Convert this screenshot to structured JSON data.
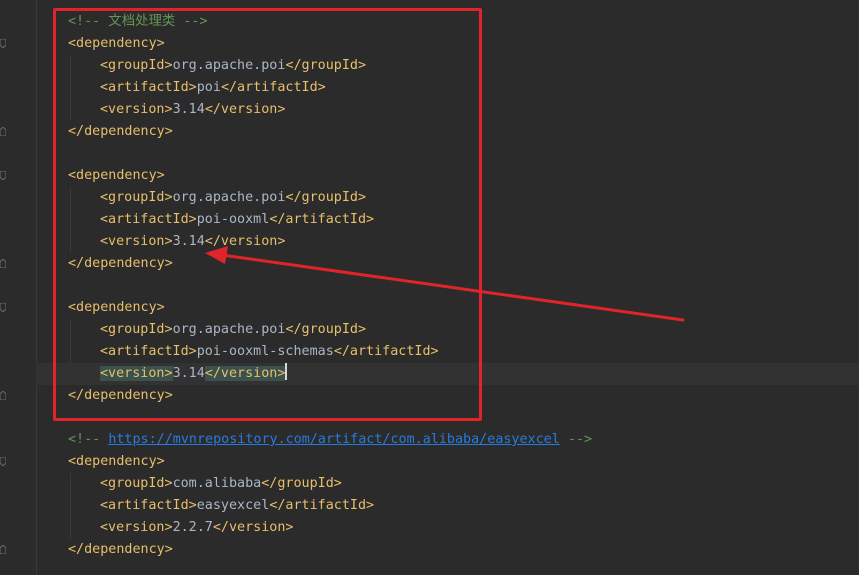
{
  "editor": {
    "comment_poi": "<!-- 文档处理类 -->",
    "dep_open": "<dependency>",
    "dep_close": "</dependency>",
    "groupId_open": "<groupId>",
    "groupId_close": "</groupId>",
    "artifactId_open": "<artifactId>",
    "artifactId_close": "</artifactId>",
    "version_open": "<version>",
    "version_close": "</version>",
    "comment_prefix": "<!-- ",
    "comment_suffix": " -->",
    "easyexcel_url": "https://mvnrepository.com/artifact/com.alibaba/easyexcel",
    "dependencies": [
      {
        "groupId": "org.apache.poi",
        "artifactId": "poi",
        "version": "3.14"
      },
      {
        "groupId": "org.apache.poi",
        "artifactId": "poi-ooxml",
        "version": "3.14"
      },
      {
        "groupId": "org.apache.poi",
        "artifactId": "poi-ooxml-schemas",
        "version": "3.14"
      },
      {
        "groupId": "com.alibaba",
        "artifactId": "easyexcel",
        "version": "2.2.7"
      }
    ]
  },
  "annotation": {
    "box_color": "#e0242b",
    "arrow_color": "#e0242b",
    "target": "version-line-poi-ooxml"
  },
  "colors": {
    "background": "#2b2b2b",
    "tag": "#e8bf6a",
    "text": "#a9b7c6",
    "comment": "#629755",
    "link": "#287bde"
  }
}
